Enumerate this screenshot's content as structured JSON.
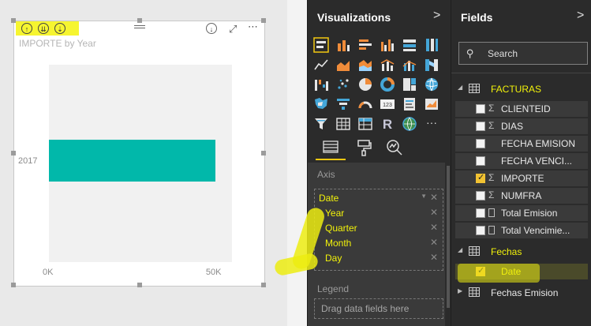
{
  "visual": {
    "title": "IMPORTE by Year",
    "header_icons": [
      "drill-up-icon",
      "expand-all-icon",
      "drill-down-icon"
    ],
    "menu_icons": [
      "focus-mode-icon",
      "expand-icon",
      "more-options-icon"
    ]
  },
  "chart_data": {
    "type": "bar",
    "orientation": "horizontal",
    "title": "IMPORTE by Year",
    "categories": [
      "2017"
    ],
    "values": [
      50000
    ],
    "xlim": [
      0,
      55000
    ],
    "xticks": [
      "0K",
      "50K"
    ],
    "xlabel": "",
    "ylabel": "",
    "colors": {
      "bar": "#01b8aa"
    }
  },
  "visualizations": {
    "title": "Visualizations",
    "chevron": ">",
    "icons": [
      "stacked-bar-icon",
      "stacked-column-icon",
      "clustered-bar-icon",
      "clustered-column-icon",
      "100-bar-icon",
      "100-column-icon",
      "line-chart-icon",
      "area-chart-icon",
      "stacked-area-icon",
      "line-column-icon",
      "line-clustered-icon",
      "ribbon-chart-icon",
      "waterfall-icon",
      "scatter-icon",
      "pie-icon",
      "donut-icon",
      "treemap-icon",
      "map-icon",
      "filled-map-icon",
      "funnel-icon",
      "gauge-icon",
      "card-icon",
      "multirow-card-icon",
      "kpi-icon",
      "slicer-icon",
      "table-icon",
      "matrix-icon",
      "r-visual-icon",
      "globe-icon",
      "more-icon"
    ],
    "r_label": "R",
    "more_label": "···",
    "tabs": [
      "fields-tab-icon",
      "format-tab-icon",
      "analytics-tab-icon"
    ],
    "axis_label": "Axis",
    "axis_field": "Date",
    "axis_levels": [
      "Year",
      "Quarter",
      "Month",
      "Day"
    ],
    "legend_label": "Legend",
    "legend_placeholder": "Drag data fields here",
    "remove_glyph": "✕",
    "dropdown_glyph": "▼"
  },
  "fields": {
    "title": "Fields",
    "chevron": ">",
    "search_placeholder": "Search",
    "tables": [
      {
        "name": "FACTURAS",
        "expanded": true,
        "highlight": true,
        "fields": [
          {
            "name": "CLIENTEID",
            "checked": false,
            "type": "sigma"
          },
          {
            "name": "DIAS",
            "checked": false,
            "type": "sigma"
          },
          {
            "name": "FECHA EMISION",
            "checked": false,
            "type": "none"
          },
          {
            "name": "FECHA VENCI...",
            "checked": false,
            "type": "none"
          },
          {
            "name": "IMPORTE",
            "checked": true,
            "type": "sigma"
          },
          {
            "name": "NUMFRA",
            "checked": false,
            "type": "sigma"
          },
          {
            "name": "Total Emision",
            "checked": false,
            "type": "calc"
          },
          {
            "name": "Total Vencimie...",
            "checked": false,
            "type": "calc"
          }
        ]
      },
      {
        "name": "Fechas",
        "expanded": true,
        "highlight": true,
        "fields": [
          {
            "name": "Date",
            "checked": true,
            "type": "none"
          }
        ]
      },
      {
        "name": "Fechas Emision",
        "expanded": false,
        "highlight": false,
        "fields": []
      }
    ],
    "sigma_glyph": "Σ",
    "expanded_glyph": "◢",
    "collapsed_glyph": "▶"
  },
  "colors": {
    "accent_yellow": "#f2f20a",
    "table_yellow": "#f1c232",
    "pane_bg": "#2b2b2b",
    "bar": "#01b8aa"
  }
}
